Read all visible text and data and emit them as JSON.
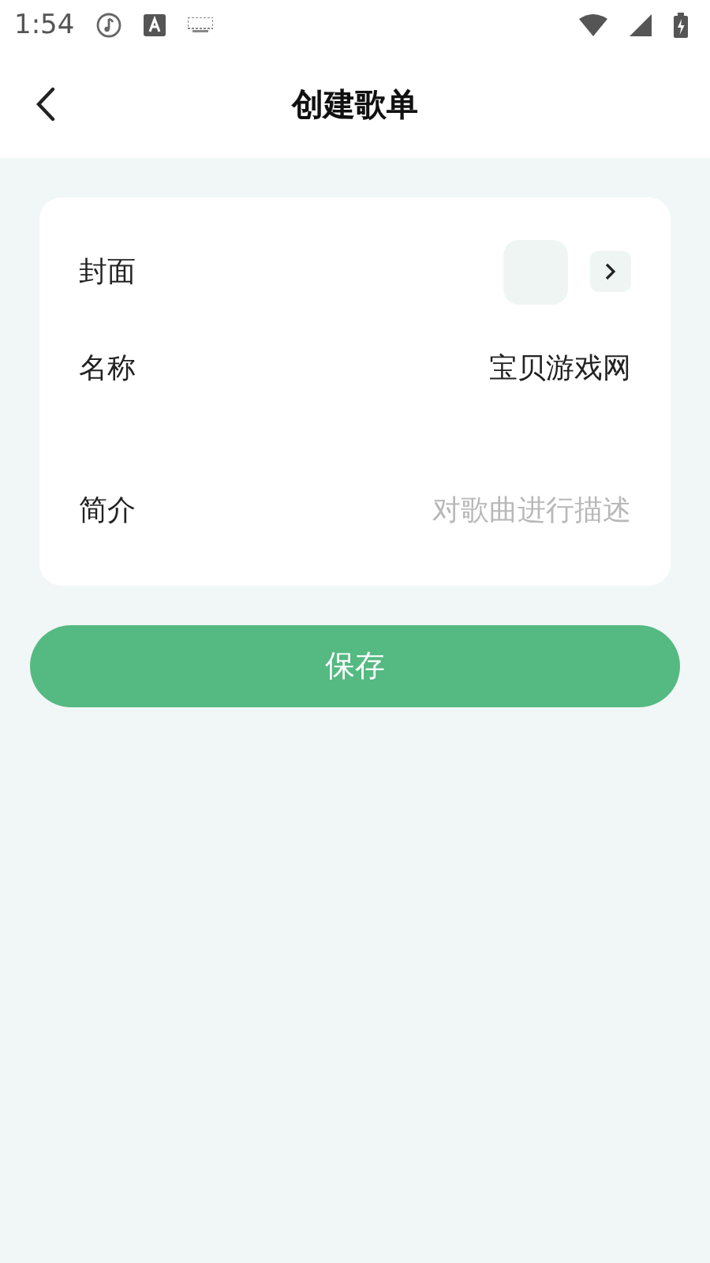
{
  "status_bar": {
    "time": "1:54"
  },
  "header": {
    "title": "创建歌单"
  },
  "form": {
    "rows": [
      {
        "kind": "cover",
        "label": "封面"
      },
      {
        "kind": "input",
        "label": "名称",
        "value": "宝贝游戏网"
      },
      {
        "kind": "input",
        "label": "简介",
        "placeholder": "对歌曲进行描述"
      }
    ]
  },
  "save_button": {
    "label": "保存"
  }
}
